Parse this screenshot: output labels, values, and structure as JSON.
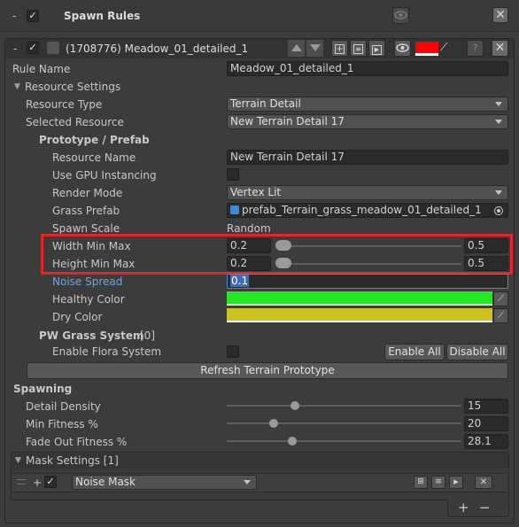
{
  "header": {
    "collapse": "-",
    "check": "✓",
    "title": "Spawn Rules"
  },
  "rule": {
    "collapse": "-",
    "check": "✓",
    "title": "(1708776) Meadow_01_detailed_1",
    "color": "#ff0000"
  },
  "rule_name": {
    "label": "Rule Name",
    "value": "Meadow_01_detailed_1"
  },
  "resource_settings": {
    "label": "Resource Settings"
  },
  "resource_type": {
    "label": "Resource Type",
    "value": "Terrain Detail"
  },
  "selected_resource": {
    "label": "Selected Resource",
    "value": "New Terrain Detail 17"
  },
  "prototype": {
    "label": "Prototype / Prefab"
  },
  "resource_name": {
    "label": "Resource Name",
    "value": "New Terrain Detail 17"
  },
  "gpu_instancing": {
    "label": "Use GPU Instancing",
    "checked": false
  },
  "render_mode": {
    "label": "Render Mode",
    "value": "Vertex Lit"
  },
  "grass_prefab": {
    "label": "Grass Prefab",
    "value": "prefab_Terrain_grass_meadow_01_detailed_1"
  },
  "spawn_scale": {
    "label": "Spawn Scale",
    "value": "Random"
  },
  "width_minmax": {
    "label": "Width Min Max",
    "min": "0.2",
    "max": "0.5"
  },
  "height_minmax": {
    "label": "Height Min Max",
    "min": "0.2",
    "max": "0.5"
  },
  "noise_spread": {
    "label": "Noise Spread",
    "value": "0.1"
  },
  "healthy_color": {
    "label": "Healthy Color",
    "color": "#22e81f"
  },
  "dry_color": {
    "label": "Dry Color",
    "color": "#cec21e"
  },
  "pw_grass": {
    "label": "PW Grass System",
    "count": "[0]"
  },
  "flora": {
    "label": "Enable Flora System",
    "enable_all": "Enable All",
    "disable_all": "Disable All"
  },
  "refresh": {
    "label": "Refresh Terrain Prototype"
  },
  "spawning": {
    "label": "Spawning"
  },
  "detail_density": {
    "label": "Detail Density",
    "value": "15",
    "fraction": 0.29
  },
  "min_fitness": {
    "label": "Min Fitness %",
    "value": "20",
    "fraction": 0.2
  },
  "fade_out": {
    "label": "Fade Out Fitness %",
    "value": "28.1",
    "fraction": 0.281
  },
  "mask_settings": {
    "label": "Mask Settings [1]"
  },
  "mask": {
    "add": "+",
    "check": "✓",
    "type": "Noise Mask",
    "remove": "✕"
  },
  "footer": {
    "add": "+",
    "remove": "−"
  },
  "colors": {
    "highlight": "#e8232b",
    "accent_blue": "#4a88d6"
  }
}
